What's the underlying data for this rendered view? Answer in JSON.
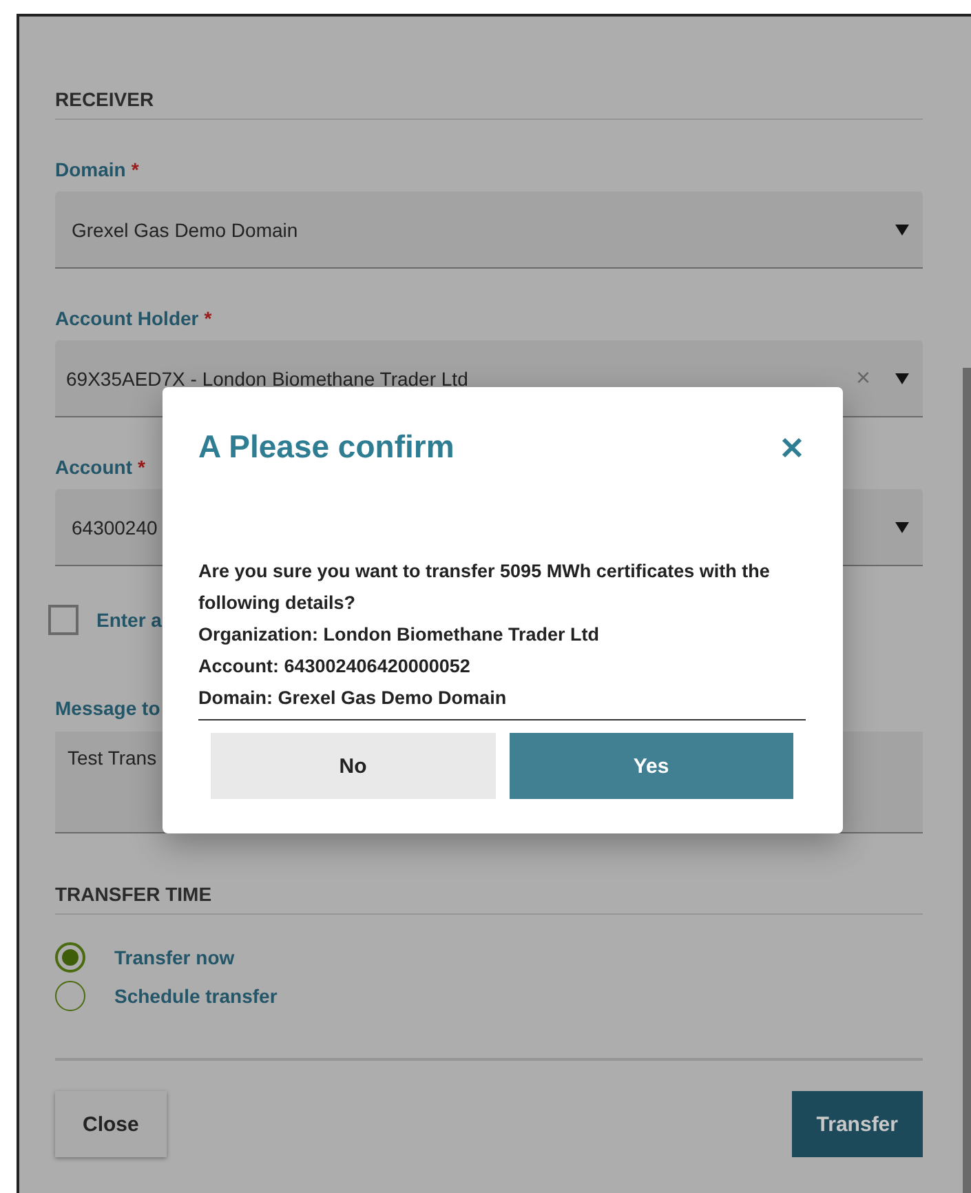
{
  "receiver": {
    "heading": "RECEIVER",
    "fields": [
      {
        "label": "Domain",
        "required_mark": "*",
        "value": "Grexel Gas Demo Domain"
      },
      {
        "label": "Account Holder",
        "required_mark": "*",
        "value": "69X35AED7X - London Biomethane Trader Ltd",
        "clear": "×"
      },
      {
        "label": "Account",
        "required_mark": "*",
        "value": "64300240"
      }
    ],
    "checkbox": {
      "label": "Enter a",
      "checked": false
    },
    "message": {
      "label": "Message to",
      "value": "Test Trans"
    }
  },
  "transfer_time": {
    "heading": "TRANSFER TIME",
    "options": [
      {
        "label": "Transfer now",
        "selected": true
      },
      {
        "label": "Schedule transfer",
        "selected": false
      }
    ]
  },
  "footer_buttons": [
    {
      "label": "Close",
      "kind": "secondary"
    },
    {
      "label": "Transfer",
      "kind": "primary"
    }
  ],
  "dialog": {
    "title": "A Please confirm",
    "lines": [
      "Are you sure you want to transfer 5095 MWh certificates with the following details?",
      "Organization: London Biomethane Trader Ltd",
      "Account: 643002406420000052",
      "Domain: Grexel Gas Demo Domain"
    ],
    "buttons": [
      {
        "label": "No",
        "kind": "secondary"
      },
      {
        "label": "Yes",
        "kind": "primary"
      }
    ]
  }
}
